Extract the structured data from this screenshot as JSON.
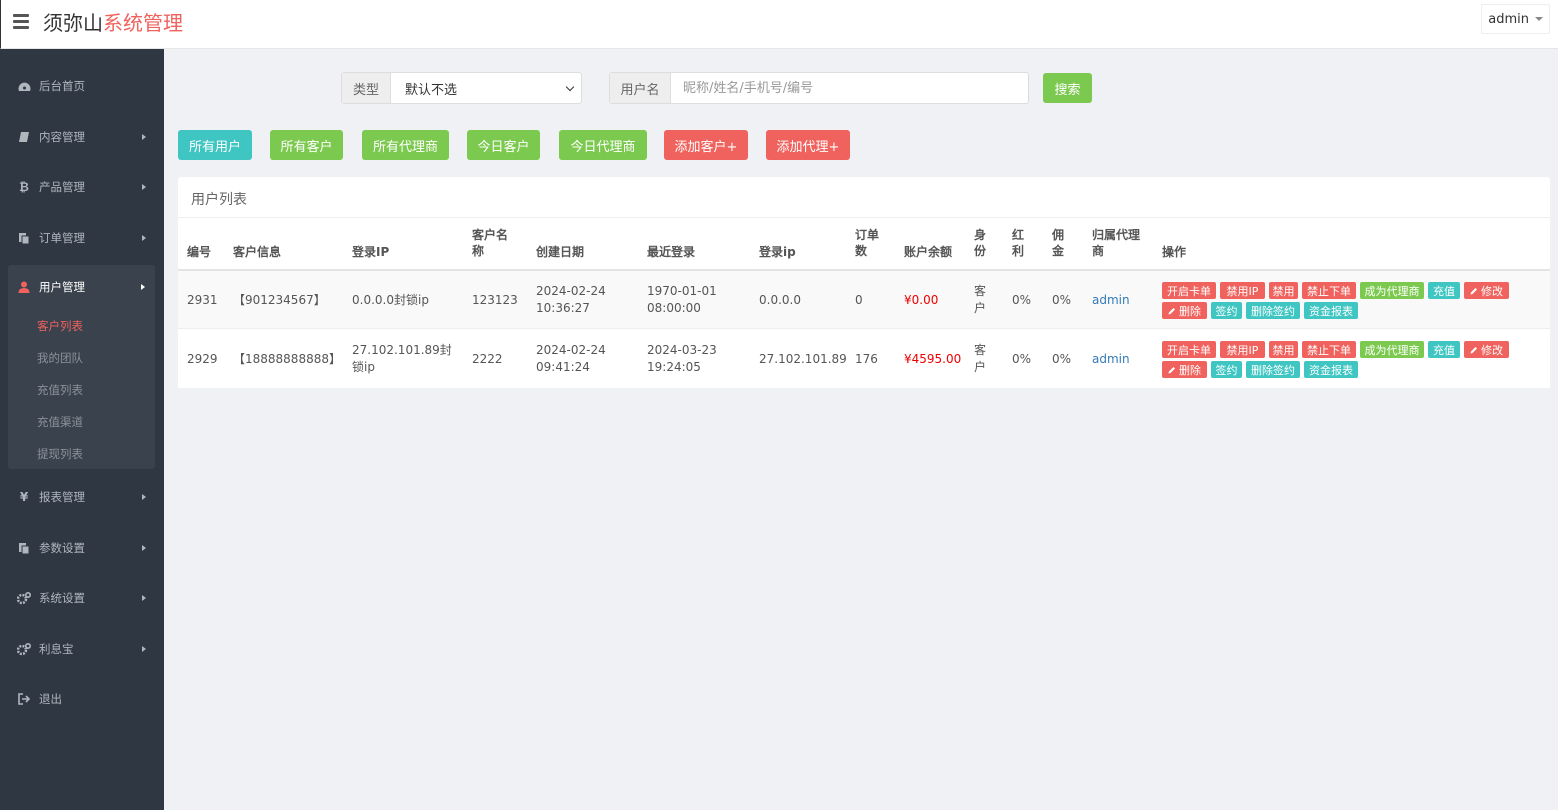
{
  "header": {
    "brand_black": "须弥山",
    "brand_red": "系统管理",
    "user": "admin"
  },
  "sidebar": {
    "items": [
      {
        "label": "后台首页",
        "icon": "dashboard-icon"
      },
      {
        "label": "内容管理",
        "icon": "book-icon"
      },
      {
        "label": "产品管理",
        "icon": "bitcoin-icon"
      },
      {
        "label": "订单管理",
        "icon": "copy-icon"
      },
      {
        "label": "用户管理",
        "icon": "user-icon"
      },
      {
        "label": "报表管理",
        "icon": "yen-icon"
      },
      {
        "label": "参数设置",
        "icon": "copy-icon"
      },
      {
        "label": "系统设置",
        "icon": "gears-icon"
      },
      {
        "label": "利息宝",
        "icon": "gears-icon"
      },
      {
        "label": "退出",
        "icon": "sign-out-icon"
      }
    ],
    "sub_items": [
      "客户列表",
      "我的团队",
      "充值列表",
      "充值渠道",
      "提现列表"
    ]
  },
  "search": {
    "type_label": "类型",
    "type_value": "默认不选",
    "name_label": "用户名",
    "name_placeholder": "昵称/姓名/手机号/编号",
    "search_button": "搜索"
  },
  "filters": [
    "所有用户",
    "所有客户",
    "所有代理商",
    "今日客户",
    "今日代理商",
    "添加客户+",
    "添加代理+"
  ],
  "panel_title": "用户列表",
  "table": {
    "headers": [
      "编号",
      "客户信息",
      "登录IP",
      "客户名称",
      "创建日期",
      "最近登录",
      "登录ip",
      "订单数",
      "账户余额",
      "身份",
      "红利",
      "佣金",
      "归属代理商",
      "操作"
    ],
    "rows": [
      {
        "id": "2931",
        "info": "【901234567】",
        "login_ip": "0.0.0.0封锁ip",
        "name": "123123",
        "created": "2024-02-24 10:36:27",
        "last_login": "1970-01-01 08:00:00",
        "ip": "0.0.0.0",
        "orders": "0",
        "balance": "¥0.00",
        "role": "客户",
        "bonus": "0%",
        "commission": "0%",
        "agent": "admin"
      },
      {
        "id": "2929",
        "info": "【18888888888】",
        "login_ip": "27.102.101.89封锁ip",
        "name": "2222",
        "created": "2024-02-24 09:41:24",
        "last_login": "2024-03-23 19:24:05",
        "ip": "27.102.101.89",
        "orders": "176",
        "balance": "¥4595.00",
        "role": "客户",
        "bonus": "0%",
        "commission": "0%",
        "agent": "admin"
      }
    ],
    "actions": [
      "开启卡单",
      "禁用IP",
      "禁用",
      "禁止下单",
      "成为代理商",
      "充值",
      "修改",
      "删除",
      "签约",
      "删除签约",
      "资金报表"
    ]
  }
}
